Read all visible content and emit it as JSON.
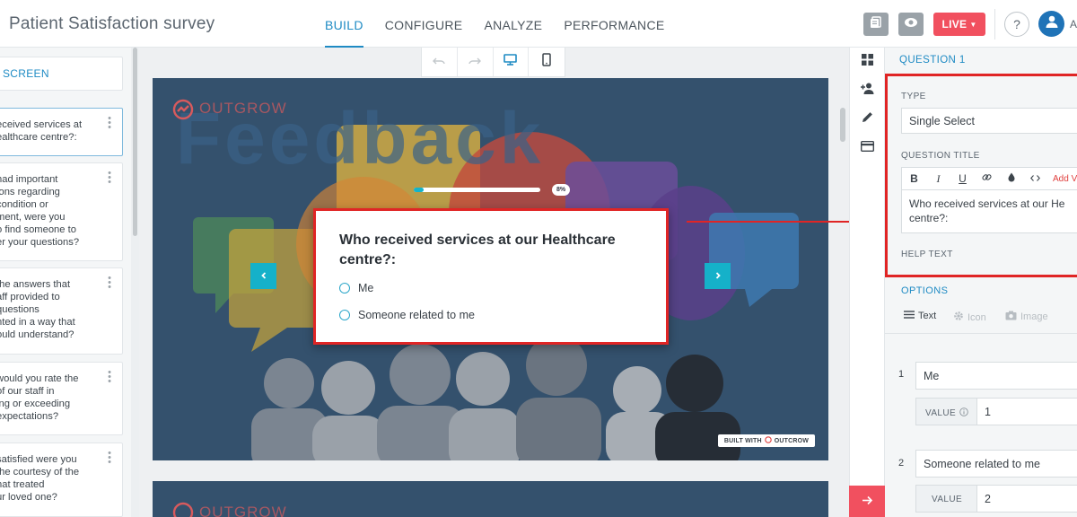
{
  "header": {
    "title": "Patient Satisfaction survey",
    "tabs": [
      {
        "label": "BUILD",
        "active": true
      },
      {
        "label": "CONFIGURE",
        "active": false
      },
      {
        "label": "ANALYZE",
        "active": false
      },
      {
        "label": "PERFORMANCE",
        "active": false
      }
    ],
    "live_label": "LIVE",
    "help_label": "?",
    "user_initial": "A"
  },
  "sidebar": {
    "screen_label": "SCREEN",
    "questions": [
      {
        "text": "eceived services at\nealthcare centre?:",
        "active": true
      },
      {
        "text": " had important\nions regarding\ncondition or\nment, were you\no find someone to\ner your questions?",
        "active": false
      },
      {
        "text": "the answers that\naff provided to\nquestions\nnted in a way that\nould understand?",
        "active": false
      },
      {
        "text": "would you rate the\nof our staff in\ning or exceeding\nexpectations?",
        "active": false
      },
      {
        "text": "satisfied were you\nthe courtesy of the\nhat treated\nur loved one?",
        "active": false
      }
    ]
  },
  "canvas": {
    "brand_text": "OUTGROW",
    "background_word": "Feedback",
    "progress": {
      "percent": 8,
      "label": "8%"
    },
    "question": {
      "title": "Who received services at our Healthcare centre?:",
      "options": [
        "Me",
        "Someone related to me"
      ]
    },
    "built_with_label": "BUILT WITH",
    "built_with_brand": "OUTCROW"
  },
  "panel": {
    "section_label": "QUESTION 1",
    "type_label": "TYPE",
    "type_value": "Single Select",
    "question_title_label": "QUESTION TITLE",
    "rte_buttons": [
      "B",
      "I",
      "U"
    ],
    "rte_add_label": "Add V",
    "question_title_value": "Who received services at our He\ncentre?:",
    "help_text_label": "HELP TEXT",
    "options_label": "OPTIONS",
    "option_tabs": [
      {
        "label": "Text",
        "active": true
      },
      {
        "label": "Icon",
        "active": false
      },
      {
        "label": "Image",
        "active": false
      }
    ],
    "options": [
      {
        "num": "1",
        "label": "Me",
        "value_label": "VALUE",
        "value": "1"
      },
      {
        "num": "2",
        "label": "Someone related to me",
        "value_label": "VALUE",
        "value": "2"
      }
    ]
  },
  "colors": {
    "accent": "#1f8bc4",
    "live": "#f1505f",
    "highlight": "#e02525",
    "slide_bg": "#34516d",
    "nav_arrow": "#15b1c9"
  }
}
